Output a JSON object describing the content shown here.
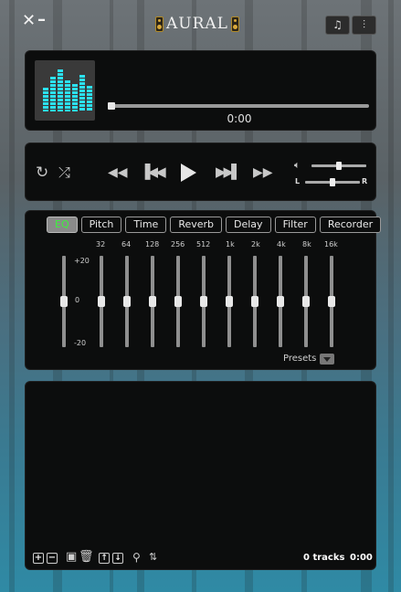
{
  "window": {
    "title": "AURAL",
    "close_glyph": "✕",
    "minimize_glyph": "–",
    "top_buttons": [
      {
        "icon": "playlist-icon",
        "glyph": "♫"
      },
      {
        "icon": "equalizer-settings-icon",
        "glyph": "⫶"
      }
    ]
  },
  "now_playing": {
    "art_icon": "spectrum-bars-icon",
    "time": "0:00",
    "progress": 0
  },
  "controls": {
    "repeat_icon": "repeat-icon",
    "shuffle_icon": "shuffle-icon",
    "rewind_icon": "rewind-icon",
    "previous_icon": "previous-track-icon",
    "play_icon": "play-icon",
    "next_icon": "next-track-icon",
    "fast_forward_icon": "fast-forward-icon",
    "volume_icon": "volume-icon",
    "balance_left": "L",
    "balance_right": "R",
    "volume_level": 0.5,
    "balance_level": 0.5
  },
  "effects": {
    "tabs": [
      "EQ",
      "Pitch",
      "Time",
      "Reverb",
      "Delay",
      "Filter",
      "Recorder"
    ],
    "active_tab": "EQ",
    "active_color": "#3df03d",
    "gain_labels": {
      "top": "+20",
      "mid": "0",
      "bottom": "-20"
    },
    "bands": [
      "32",
      "64",
      "128",
      "256",
      "512",
      "1k",
      "2k",
      "4k",
      "8k",
      "16k"
    ],
    "band_gains": [
      0,
      0,
      0,
      0,
      0,
      0,
      0,
      0,
      0,
      0
    ],
    "presets_label": "Presets"
  },
  "playlist": {
    "track_count": "0 tracks",
    "duration": "0:00"
  }
}
